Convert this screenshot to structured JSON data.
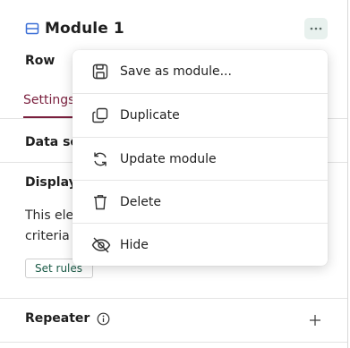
{
  "header": {
    "title": "Module 1",
    "module_icon": "module-icon",
    "more_icon": "more-horizontal-icon"
  },
  "row_label": "Row",
  "tabs": {
    "active_label": "Settings"
  },
  "sections": {
    "data_source_label": "Data so",
    "display_label": "Display",
    "description_line1": "This ele",
    "description_line2": "criteria",
    "set_rules_label": "Set rules",
    "repeater_label": "Repeater",
    "repeater_info_icon": "info-icon",
    "repeater_add_icon": "plus-icon"
  },
  "menu": {
    "items": [
      {
        "label": "Save as module...",
        "icon": "save-icon"
      },
      {
        "label": "Duplicate",
        "icon": "duplicate-icon"
      },
      {
        "label": "Update module",
        "icon": "refresh-icon"
      },
      {
        "label": "Delete",
        "icon": "trash-icon"
      },
      {
        "label": "Hide",
        "icon": "eye-off-icon"
      }
    ]
  },
  "colors": {
    "accent": "#7a1f3d",
    "module_icon": "#3b6fd6",
    "button_bg": "#e8f1ee",
    "rules_text": "#1a5a46"
  }
}
